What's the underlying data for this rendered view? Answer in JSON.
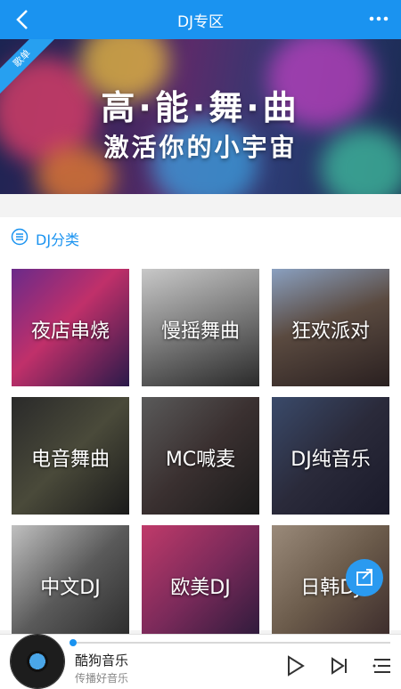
{
  "header": {
    "title": "DJ专区",
    "back_icon": "chevron-left-icon",
    "more_icon": "more-dots-icon",
    "bg_color": "#1a93f0"
  },
  "banner": {
    "tag": "歌单",
    "title_line1": "高·能·舞·曲",
    "title_line2": "激活你的小宇宙"
  },
  "category": {
    "title": "DJ分类",
    "icon": "list-circle-icon",
    "accent": "#1a93f0"
  },
  "tiles": [
    {
      "label": "夜店串烧"
    },
    {
      "label": "慢摇舞曲"
    },
    {
      "label": "狂欢派对"
    },
    {
      "label": "电音舞曲"
    },
    {
      "label": "MC喊麦"
    },
    {
      "label": "DJ纯音乐"
    },
    {
      "label": "中文DJ"
    },
    {
      "label": "欧美DJ"
    },
    {
      "label": "日韩DJ"
    }
  ],
  "share_icon": "share-icon",
  "player": {
    "song": "酷狗音乐",
    "artist": "传播好音乐",
    "progress": 0.0,
    "play_icon": "play-icon",
    "next_icon": "next-icon",
    "playlist_icon": "playlist-icon"
  }
}
